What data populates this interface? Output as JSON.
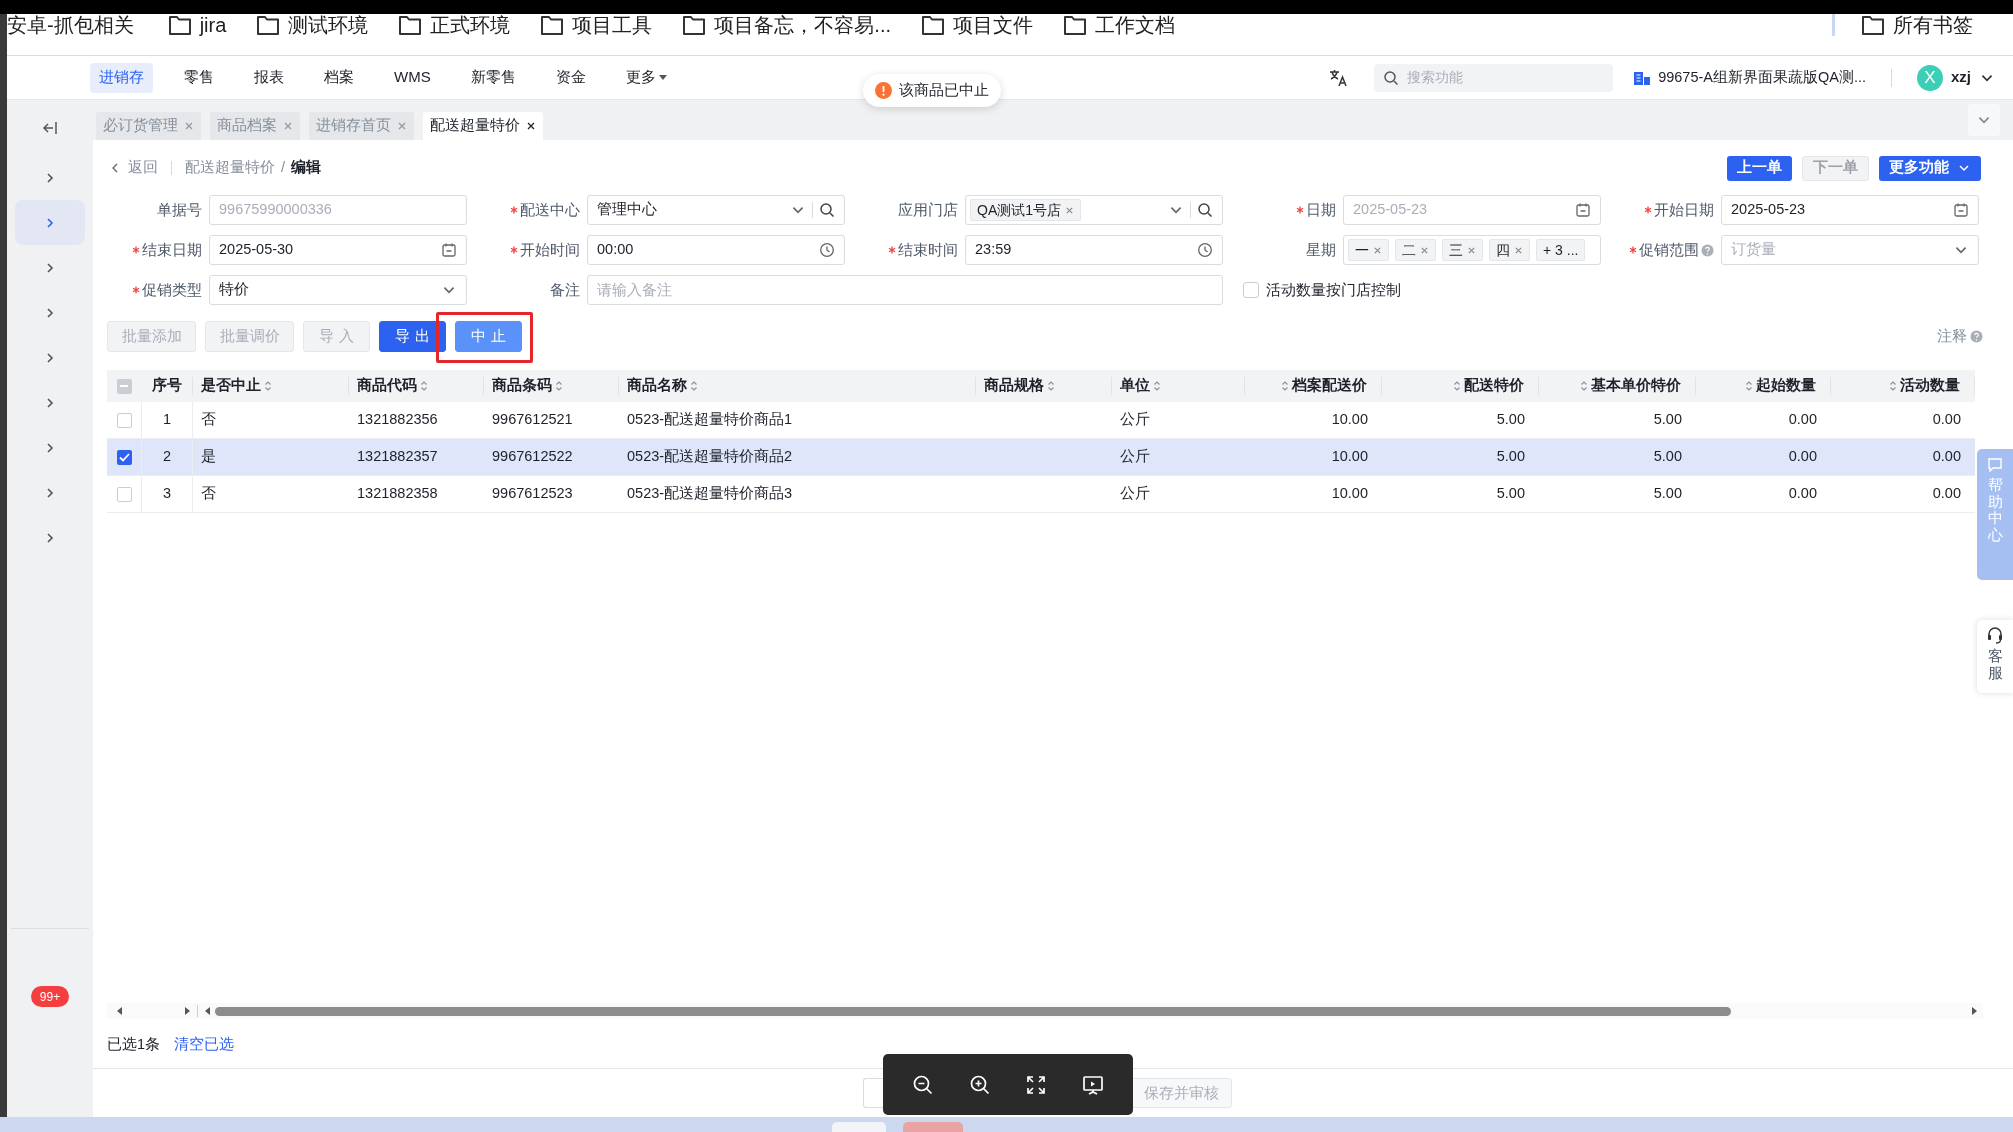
{
  "bookmarks": [
    {
      "label": "安卓-抓包相关",
      "folder": false
    },
    {
      "label": "jira",
      "folder": true
    },
    {
      "label": "测试环境",
      "folder": true
    },
    {
      "label": "正式环境",
      "folder": true
    },
    {
      "label": "项目工具",
      "folder": true
    },
    {
      "label": "项目备忘，不容易...",
      "folder": true
    },
    {
      "label": "项目文件",
      "folder": true
    },
    {
      "label": "工作文档",
      "folder": true
    }
  ],
  "all_bookmarks": "所有书签",
  "nav": {
    "items": [
      {
        "label": "进销存",
        "selected": true,
        "menu": false
      },
      {
        "label": "零售",
        "selected": false,
        "menu": false
      },
      {
        "label": "报表",
        "selected": false,
        "menu": false
      },
      {
        "label": "档案",
        "selected": false,
        "menu": false
      },
      {
        "label": "WMS",
        "selected": false,
        "menu": false
      },
      {
        "label": "新零售",
        "selected": false,
        "menu": false
      },
      {
        "label": "资金",
        "selected": false,
        "menu": false
      },
      {
        "label": "更多",
        "selected": false,
        "menu": true
      }
    ],
    "search": {
      "placeholder": "搜索功能"
    },
    "store": "99675-A组新界面果蔬版QA测...",
    "user": {
      "initial": "X",
      "name": "xzj"
    }
  },
  "toast": "该商品已中止",
  "tabs": [
    {
      "label": "必订货管理",
      "selected": false
    },
    {
      "label": "商品档案",
      "selected": false
    },
    {
      "label": "进销存首页",
      "selected": false
    },
    {
      "label": "配送超量特价",
      "selected": true
    }
  ],
  "sidebar": {
    "items": [
      {
        "selected": false
      },
      {
        "selected": true
      },
      {
        "selected": false
      },
      {
        "selected": false
      },
      {
        "selected": false
      },
      {
        "selected": false
      },
      {
        "selected": false
      },
      {
        "selected": false
      },
      {
        "selected": false
      }
    ],
    "badge": "99+"
  },
  "breadcrumb": {
    "back": "返回",
    "path": "配送超量特价",
    "separator": "/",
    "current": "编辑"
  },
  "record_buttons": [
    {
      "label": "上一单",
      "disabled": false,
      "menu": false
    },
    {
      "label": "下一单",
      "disabled": true,
      "menu": false
    },
    {
      "label": "更多功能",
      "disabled": false,
      "menu": true
    }
  ],
  "form": {
    "rows": [
      [
        {
          "label": "单据号",
          "kind": "text",
          "value": "99675990000336",
          "disabled": true
        },
        {
          "label": "配送中心",
          "required": true,
          "kind": "select",
          "value": "管理中心",
          "disabled": false,
          "search": true
        },
        {
          "label": "应用门店",
          "kind": "tags",
          "tags": [
            "QA测试1号店"
          ],
          "dropdown": true,
          "search": true
        },
        {
          "label": "日期",
          "required": true,
          "kind": "date",
          "value": "2025-05-23",
          "disabled": true
        },
        {
          "label": "开始日期",
          "required": true,
          "kind": "date",
          "value": "2025-05-23",
          "disabled": false
        }
      ],
      [
        {
          "label": "结束日期",
          "required": true,
          "kind": "date",
          "value": "2025-05-30",
          "disabled": false
        },
        {
          "label": "开始时间",
          "required": true,
          "kind": "time",
          "value": "00:00",
          "disabled": false
        },
        {
          "label": "结束时间",
          "required": true,
          "kind": "time",
          "value": "23:59",
          "disabled": false
        },
        {
          "label": "星期",
          "kind": "tags",
          "tags": [
            "一",
            "二",
            "三",
            "四"
          ],
          "more": "+ 3 ..."
        },
        {
          "label": "促销范围",
          "required": true,
          "help": true,
          "kind": "select",
          "value": "订货量",
          "disabled": true
        }
      ],
      [
        {
          "label": "促销类型",
          "required": true,
          "kind": "select",
          "value": "特价",
          "disabled": false
        },
        {
          "label": "备注",
          "kind": "note",
          "placeholder": "请输入备注"
        }
      ]
    ],
    "checkbox": {
      "label": "活动数量按门店控制",
      "checked": false
    }
  },
  "actions": [
    {
      "label": "批量添加",
      "kind": "default",
      "disabled": true,
      "focused": false,
      "annotated": false
    },
    {
      "label": "批量调价",
      "kind": "default",
      "disabled": true,
      "focused": false,
      "annotated": false
    },
    {
      "label": "导 入",
      "kind": "default",
      "disabled": true,
      "focused": false,
      "annotated": false
    },
    {
      "label": "导 出",
      "kind": "primary",
      "disabled": false,
      "focused": false,
      "annotated": false
    },
    {
      "label": "中 止",
      "kind": "primary",
      "disabled": false,
      "focused": true,
      "annotated": true
    }
  ],
  "notes_link": "注释",
  "table": {
    "header_checkbox": {
      "checked": false,
      "indeterminate": true
    },
    "columns": [
      {
        "label": "序号"
      },
      {
        "label": "是否中止",
        "sortable": true
      },
      {
        "label": "商品代码",
        "sortable": true
      },
      {
        "label": "商品条码",
        "sortable": true
      },
      {
        "label": "商品名称",
        "sortable": true
      },
      {
        "label": "商品规格",
        "sortable": true
      },
      {
        "label": "单位",
        "sortable": true
      },
      {
        "label": "档案配送价",
        "sortable": true
      },
      {
        "label": "配送特价",
        "sortable": true
      },
      {
        "label": "基本单价特价",
        "sortable": true
      },
      {
        "label": "起始数量",
        "sortable": true
      },
      {
        "label": "活动数量",
        "sortable": true
      }
    ],
    "rows": [
      {
        "selected": false,
        "cells": [
          "1",
          "否",
          "1321882356",
          "9967612521",
          "0523-配送超量特价商品1",
          "",
          "公斤",
          "10.00",
          "5.00",
          "5.00",
          "0.00",
          "0.00"
        ]
      },
      {
        "selected": true,
        "cells": [
          "2",
          "是",
          "1321882357",
          "9967612522",
          "0523-配送超量特价商品2",
          "",
          "公斤",
          "10.00",
          "5.00",
          "5.00",
          "0.00",
          "0.00"
        ]
      },
      {
        "selected": false,
        "cells": [
          "3",
          "否",
          "1321882358",
          "9967612523",
          "0523-配送超量特价商品3",
          "",
          "公斤",
          "10.00",
          "5.00",
          "5.00",
          "0.00",
          "0.00"
        ]
      }
    ]
  },
  "footer": {
    "selected_count": "已选1条",
    "clear": "清空已选"
  },
  "bottom_buttons": [
    {
      "label": "保存并审核",
      "disabled": true
    }
  ],
  "help": {
    "help_center": "帮助中心",
    "service": "客服"
  }
}
